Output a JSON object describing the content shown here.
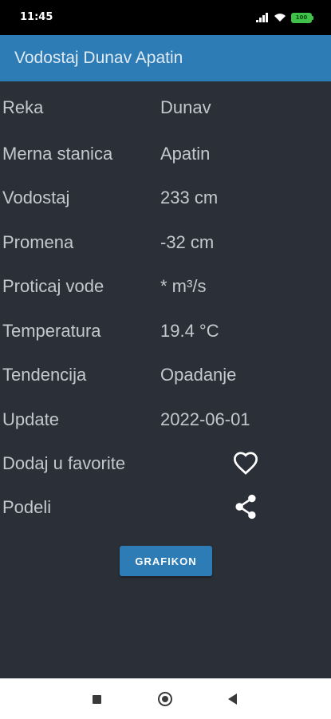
{
  "status_bar": {
    "time": "11:45",
    "battery": "100",
    "icons": [
      "signal-icon",
      "wifi-icon",
      "battery-icon"
    ]
  },
  "app_bar": {
    "title": "Vodostaj Dunav Apatin",
    "color": "#2d7cb6"
  },
  "details": {
    "reka": {
      "label": "Reka",
      "value": "Dunav"
    },
    "stanica": {
      "label": "Merna stanica",
      "value": "Apatin"
    },
    "vodostaj": {
      "label": "Vodostaj",
      "value": "233 cm"
    },
    "promena": {
      "label": "Promena",
      "value": "-32 cm"
    },
    "proticaj": {
      "label": "Proticaj vode",
      "value": "* m³/s"
    },
    "temperatura": {
      "label": "Temperatura",
      "value": "19.4 °C"
    },
    "tendencija": {
      "label": "Tendencija",
      "value": "Opadanje"
    },
    "update": {
      "label": "Update",
      "value": "2022-06-01"
    }
  },
  "actions": {
    "favorite": {
      "label": "Dodaj u favorite",
      "icon": "heart-outline-icon"
    },
    "share": {
      "label": "Podeli",
      "icon": "share-icon"
    }
  },
  "grafikon_button": "GRAFIKON",
  "nav_bar": {
    "icons": [
      "recent-apps-icon",
      "home-icon",
      "back-icon"
    ]
  }
}
